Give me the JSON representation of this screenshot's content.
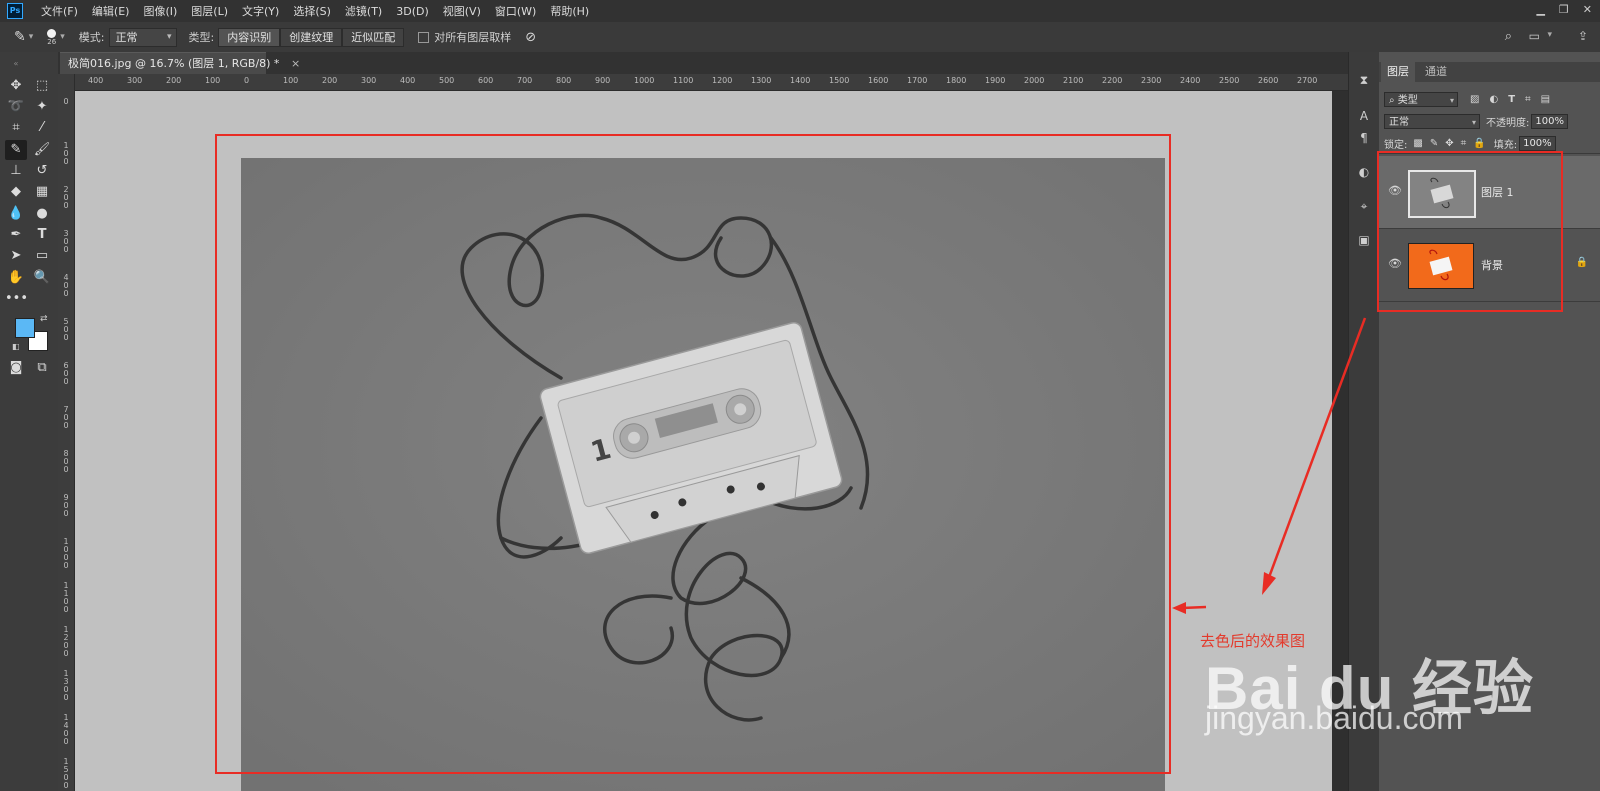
{
  "menu": {
    "logo": "Ps",
    "items": [
      "文件(F)",
      "编辑(E)",
      "图像(I)",
      "图层(L)",
      "文字(Y)",
      "选择(S)",
      "滤镜(T)",
      "3D(D)",
      "视图(V)",
      "窗口(W)",
      "帮助(H)"
    ]
  },
  "options_bar": {
    "brush_size": "26",
    "mode_label": "模式:",
    "mode_value": "正常",
    "type_label": "类型:",
    "type_options": [
      "内容识别",
      "创建纹理",
      "近似匹配"
    ],
    "sample_all_label": "对所有图层取样"
  },
  "document": {
    "tab_title": "极简016.jpg @ 16.7% (图层 1, RGB/8) *",
    "close": "×"
  },
  "ruler": {
    "h_labels": [
      "400",
      "300",
      "200",
      "100",
      "0",
      "100",
      "200",
      "300",
      "400",
      "500",
      "600",
      "700",
      "800",
      "900",
      "1000",
      "1100",
      "1200",
      "1300",
      "1400",
      "1500",
      "1600",
      "1700",
      "1800",
      "1900",
      "2000",
      "2100",
      "2200",
      "2300",
      "2400",
      "2500",
      "2600",
      "2700"
    ],
    "v_labels": [
      "0",
      "100",
      "200",
      "300",
      "400",
      "500",
      "600",
      "700",
      "800",
      "900",
      "1000",
      "1100",
      "1200",
      "1300",
      "1400",
      "1500"
    ]
  },
  "layers_panel": {
    "tabs": [
      "图层",
      "通道"
    ],
    "filter_type": "类型",
    "blend_mode": "正常",
    "opacity_label": "不透明度:",
    "opacity_value": "100%",
    "lock_label": "锁定:",
    "fill_label": "填充:",
    "fill_value": "100%",
    "layers": [
      {
        "name": "图层 1",
        "locked": false
      },
      {
        "name": "背景",
        "locked": true
      }
    ]
  },
  "colors": {
    "foreground": "#5bb8f5",
    "background": "#ffffff",
    "annotation_red": "#e82c24",
    "bg_layer_orange": "#f26a1b"
  },
  "annotation": {
    "note": "去色后的效果图"
  },
  "watermark": {
    "brand": "Bai du 经验",
    "url": "jingyan.baidu.com"
  }
}
